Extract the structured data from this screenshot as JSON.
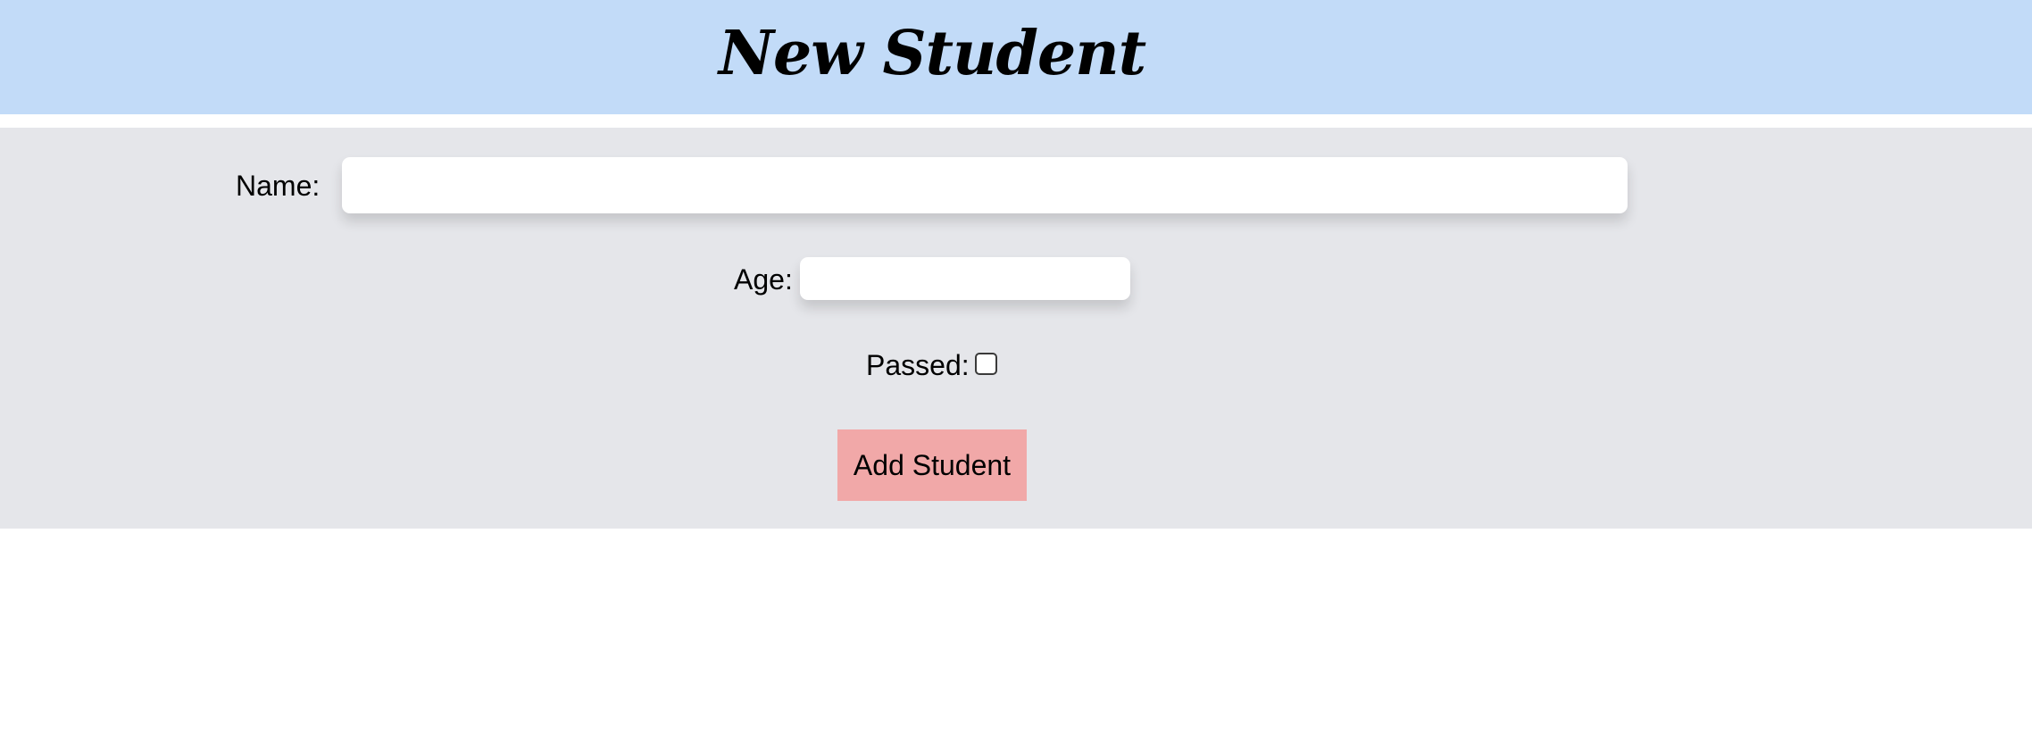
{
  "header": {
    "title": "New Student"
  },
  "form": {
    "name_label": "Name:",
    "name_value": "",
    "age_label": "Age:",
    "age_value": "",
    "passed_label": "Passed:",
    "passed_checked": false,
    "submit_label": "Add Student"
  },
  "colors": {
    "header_background": "#c2dbf8",
    "form_background": "#e5e6ea",
    "button_background": "#f1a8a8"
  }
}
